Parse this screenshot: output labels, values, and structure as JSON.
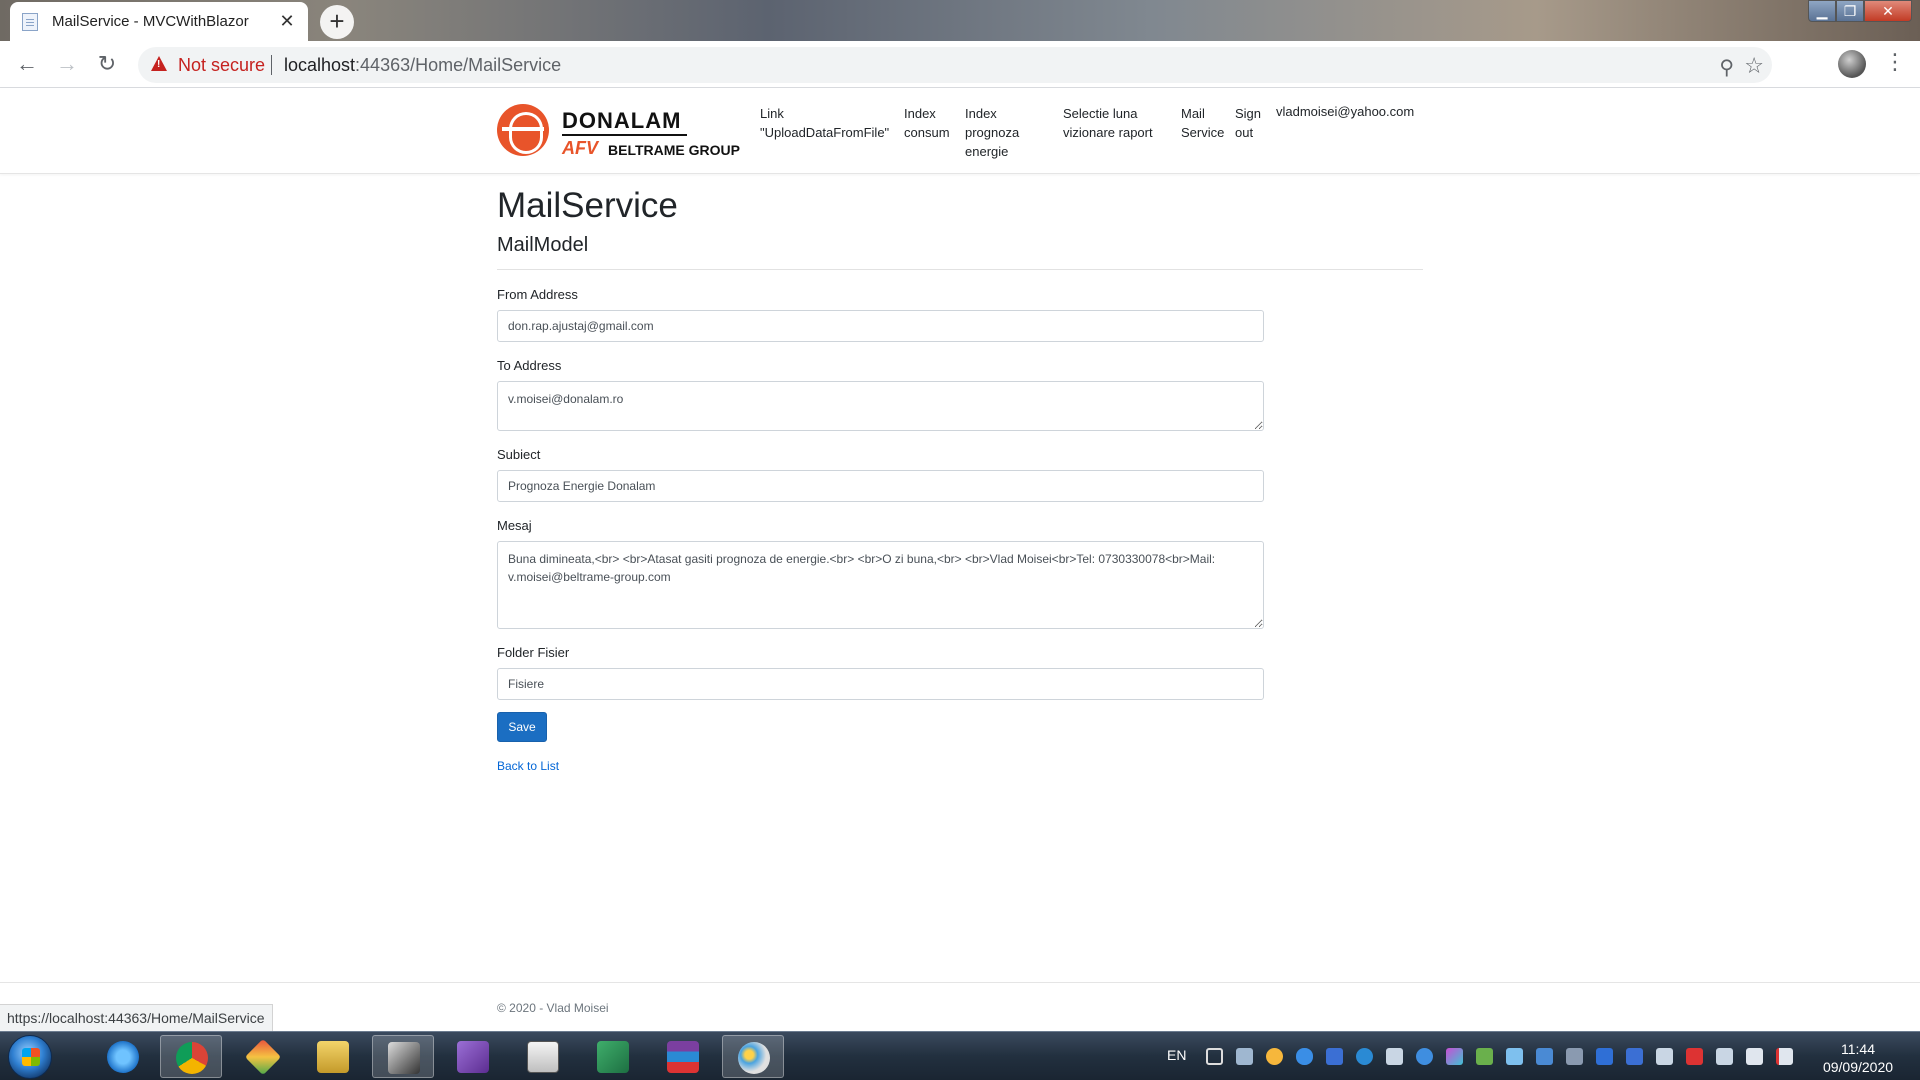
{
  "browser": {
    "tab_title": "MailService - MVCWithBlazor",
    "tab_close": "✕",
    "new_tab": "+",
    "not_secure": "Not secure",
    "url_host": "localhost",
    "url_rest": ":44363/Home/MailService",
    "status_url": "https://localhost:44363/Home/MailService"
  },
  "header": {
    "brand": "DONALAM",
    "brand_sub_afv": "AFV",
    "brand_sub_group": "BELTRAME GROUP",
    "nav": [
      {
        "l1": "Link",
        "l2": "\"UploadDataFromFile\"",
        "l3": ""
      },
      {
        "l1": "Index",
        "l2": "consum",
        "l3": ""
      },
      {
        "l1": "Index",
        "l2": "prognoza",
        "l3": "energie"
      },
      {
        "l1": "Selectie luna",
        "l2": "vizionare raport",
        "l3": ""
      },
      {
        "l1": "Mail",
        "l2": "Service",
        "l3": ""
      },
      {
        "l1": "Sign",
        "l2": "out",
        "l3": ""
      }
    ],
    "user": "vladmoisei@yahoo.com"
  },
  "main": {
    "title": "MailService",
    "subtitle": "MailModel",
    "fields": {
      "from_label": "From Address",
      "from_value": "don.rap.ajustaj@gmail.com",
      "to_label": "To Address",
      "to_value": "v.moisei@donalam.ro",
      "subject_label": "Subiect",
      "subject_value": "Prognoza Energie Donalam",
      "message_label": "Mesaj",
      "message_value": "Buna dimineata,<br> <br>Atasat gasiti prognoza de energie.<br> <br>O zi buna,<br> <br>Vlad Moisei<br>Tel: 0730330078<br>Mail: v.moisei@beltrame-group.com",
      "folder_label": "Folder Fisier",
      "folder_value": "Fisiere"
    },
    "save_label": "Save",
    "back_label": "Back to List"
  },
  "footer": {
    "text": "© 2020 - Vlad Moisei"
  },
  "taskbar": {
    "language": "EN",
    "time": "11:44",
    "date": "09/09/2020",
    "apps": [
      "internet-explorer",
      "chrome",
      "git-tool",
      "database-tool",
      "inkscape",
      "visual-studio",
      "calculator",
      "excel",
      "winrar",
      "paint"
    ]
  },
  "colors": {
    "primary_button": "#1b6ec2",
    "link": "#0366d6",
    "brand_orange": "#e8542a",
    "not_secure_red": "#c5221f"
  }
}
